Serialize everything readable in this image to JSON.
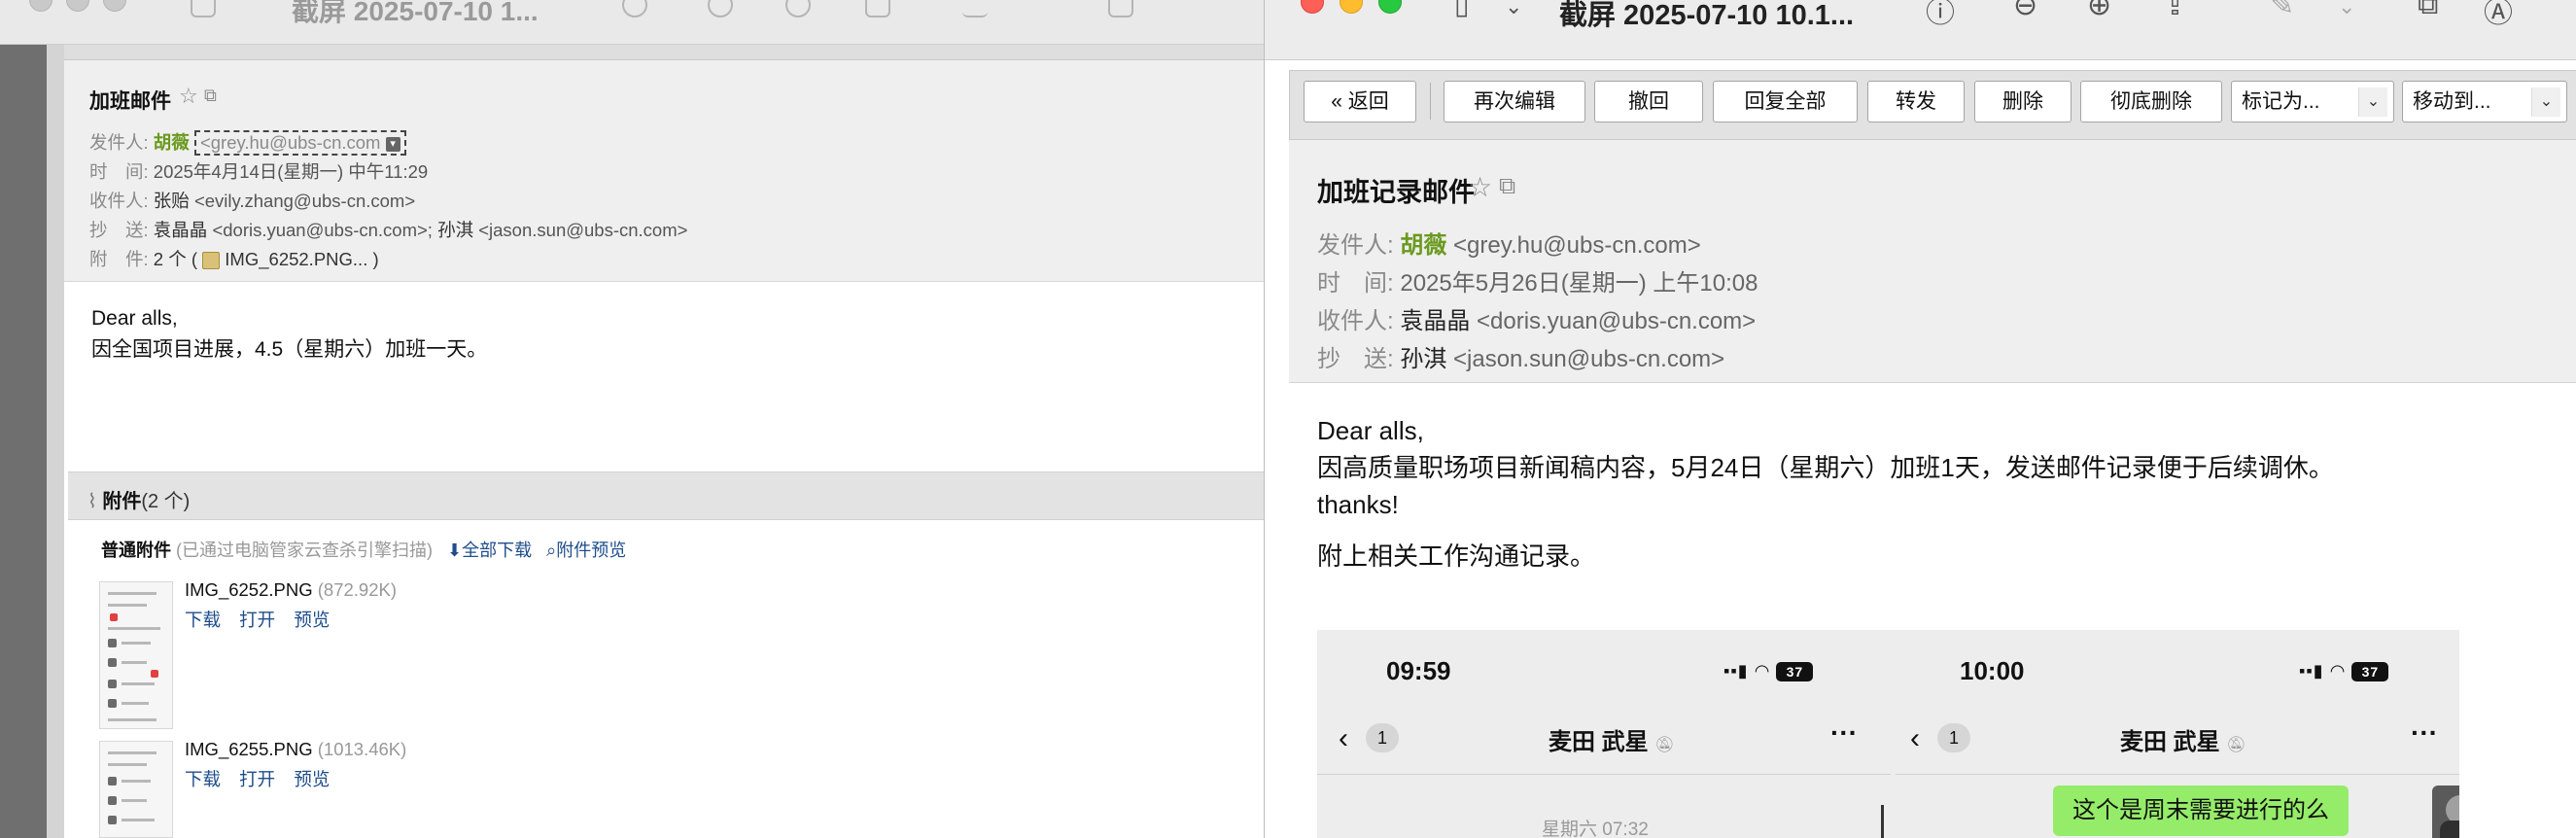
{
  "left_window": {
    "title": "截屏 2025-07-10 1...",
    "subject": "加班邮件",
    "from_label": "发件人:",
    "from_name": "胡薇",
    "from_email": "<grey.hu@ubs-cn.com",
    "time_label": "时　间:",
    "time_value": "2025年4月14日(星期一) 中午11:29",
    "to_label": "收件人:",
    "to_name": "张贻",
    "to_email": "<evily.zhang@ubs-cn.com>",
    "cc_label": "抄　送:",
    "cc_name1": "袁晶晶",
    "cc_email1": "<doris.yuan@ubs-cn.com>;",
    "cc_name2": "孙淇",
    "cc_email2": "<jason.sun@ubs-cn.com>",
    "att_label": "附　件:",
    "att_value": "2 个 (",
    "att_file": "IMG_6252.PNG...",
    "att_close": ")",
    "body_line1": "Dear alls,",
    "body_line2": "因全国项目进展，4.5（星期六）加班一天。",
    "attachments_title": "附件",
    "attachments_count": "(2 个)",
    "att_section_label": "普通附件",
    "att_section_note": "(已通过电脑管家云查杀引擎扫描)",
    "download_all": "全部下载",
    "preview_attachments": "附件预览",
    "files": [
      {
        "name": "IMG_6252.PNG",
        "size": "(872.92K)",
        "actions": [
          "下载",
          "打开",
          "预览"
        ]
      },
      {
        "name": "IMG_6255.PNG",
        "size": "(1013.46K)",
        "actions": [
          "下载",
          "打开",
          "预览"
        ]
      }
    ]
  },
  "right_window": {
    "title": "截屏 2025-07-10 10.1...",
    "toolbar": {
      "back": "« 返回",
      "reedit": "再次编辑",
      "recall": "撤回",
      "reply_all": "回复全部",
      "forward": "转发",
      "delete": "删除",
      "delete_perm": "彻底删除",
      "mark_as": "标记为...",
      "move_to": "移动到..."
    },
    "subject": "加班记录邮件",
    "from_label": "发件人:",
    "from_name": "胡薇",
    "from_email": "<grey.hu@ubs-cn.com>",
    "time_label": "时　间:",
    "time_value": "2025年5月26日(星期一) 上午10:08",
    "to_label": "收件人:",
    "to_name": "袁晶晶",
    "to_email": "<doris.yuan@ubs-cn.com>",
    "cc_label": "抄　送:",
    "cc_name": "孙淇",
    "cc_email": "<jason.sun@ubs-cn.com>",
    "body_line1": "Dear alls,",
    "body_line2": "因高质量职场项目新闻稿内容，5月24日（星期六）加班1天，发送邮件记录便于后续调休。",
    "body_line3": "thanks!",
    "body_line4": "附上相关工作沟通记录。",
    "phone1": {
      "time": "09:59",
      "battery": "37",
      "badge": "1",
      "chat_name": "麦田 武星",
      "timestamp": "星期六 07:32"
    },
    "phone2": {
      "time": "10:00",
      "battery": "37",
      "badge": "1",
      "chat_name": "麦田 武星",
      "bubble": "这个是周末需要进行的么"
    }
  }
}
